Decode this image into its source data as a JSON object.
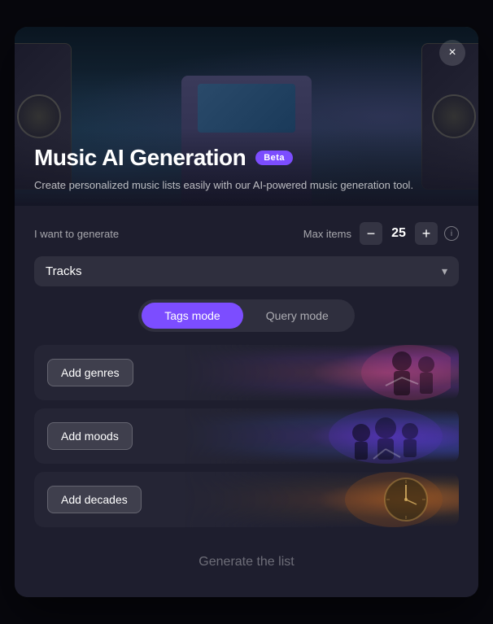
{
  "modal": {
    "title": "Music AI Generation",
    "beta_badge": "Beta",
    "subtitle": "Create personalized music lists easily with our AI-powered music generation tool.",
    "close_label": "×"
  },
  "controls": {
    "generate_label": "I want to generate",
    "max_items_label": "Max items",
    "type_value": "Tracks",
    "stepper_value": "25",
    "stepper_minus": "−",
    "stepper_plus": "+"
  },
  "mode_toggle": {
    "tags_label": "Tags mode",
    "query_label": "Query mode",
    "active": "tags"
  },
  "tag_rows": [
    {
      "id": "genres",
      "label": "Add genres"
    },
    {
      "id": "moods",
      "label": "Add moods"
    },
    {
      "id": "decades",
      "label": "Add decades"
    }
  ],
  "generate_btn": {
    "label": "Generate the list"
  },
  "icons": {
    "chevron_down": "▾",
    "info": "i"
  }
}
